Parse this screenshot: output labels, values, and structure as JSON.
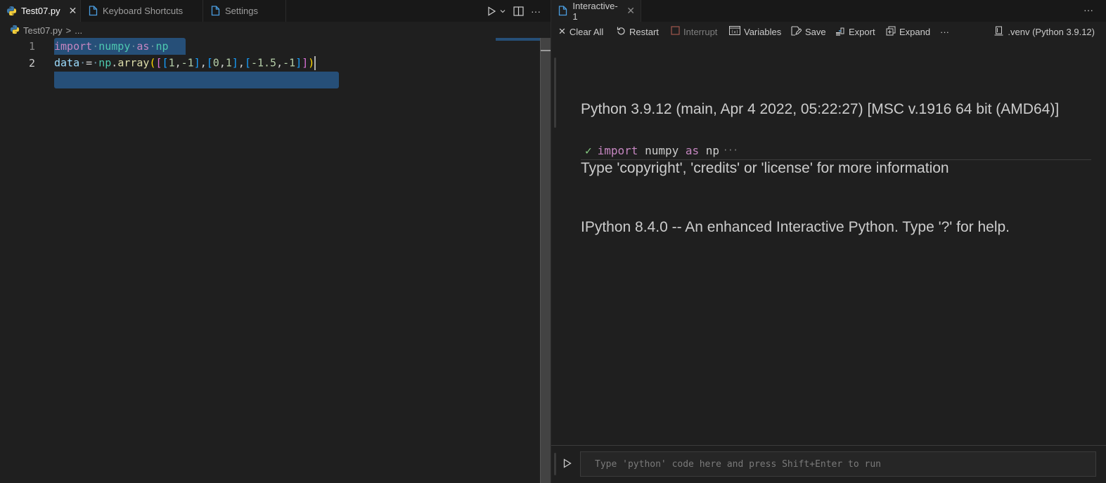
{
  "left": {
    "tabs": [
      {
        "label": "Test07.py",
        "icon": "python-icon",
        "active": true
      },
      {
        "label": "Keyboard Shortcuts",
        "icon": "file-icon",
        "active": false
      },
      {
        "label": "Settings",
        "icon": "file-icon",
        "active": false
      }
    ],
    "actions": {
      "run": "run-icon",
      "run_dropdown": "chevron-down-icon",
      "split": "split-editor-icon",
      "more": "···"
    },
    "breadcrumb": {
      "file": "Test07.py",
      "separator": ">",
      "rest": "..."
    },
    "lines": [
      {
        "number": "1",
        "text": "import numpy as np"
      },
      {
        "number": "2",
        "text": "data = np.array([[1,-1],[0,1],[-1.5,-1]])"
      }
    ]
  },
  "right": {
    "tab": {
      "label": "Interactive-1",
      "icon": "file-icon"
    },
    "more": "···",
    "toolbar": {
      "clear_all": "Clear All",
      "restart": "Restart",
      "interrupt": "Interrupt",
      "variables": "Variables",
      "save": "Save",
      "export": "Export",
      "expand": "Expand",
      "more": "···",
      "kernel": ".venv (Python 3.9.12)"
    },
    "output_lines": [
      "Python 3.9.12 (main, Apr 4 2022, 05:22:27) [MSC v.1916 64 bit (AMD64)]",
      "Type 'copyright', 'credits' or 'license' for more information",
      "IPython 8.4.0 -- An enhanced Interactive Python. Type '?' for help."
    ],
    "cell": {
      "status": "success",
      "kw1": "import",
      "mod": "numpy",
      "kw2": "as",
      "alias": "np",
      "collapsed": "···"
    },
    "input": {
      "placeholder": "Type 'python' code here and press Shift+Enter to run",
      "value": ""
    }
  },
  "colors": {
    "accent": "#0078d4",
    "selection": "#264f78",
    "keyword": "#c586c0",
    "module": "#4ec9b0",
    "success": "#89d185"
  }
}
